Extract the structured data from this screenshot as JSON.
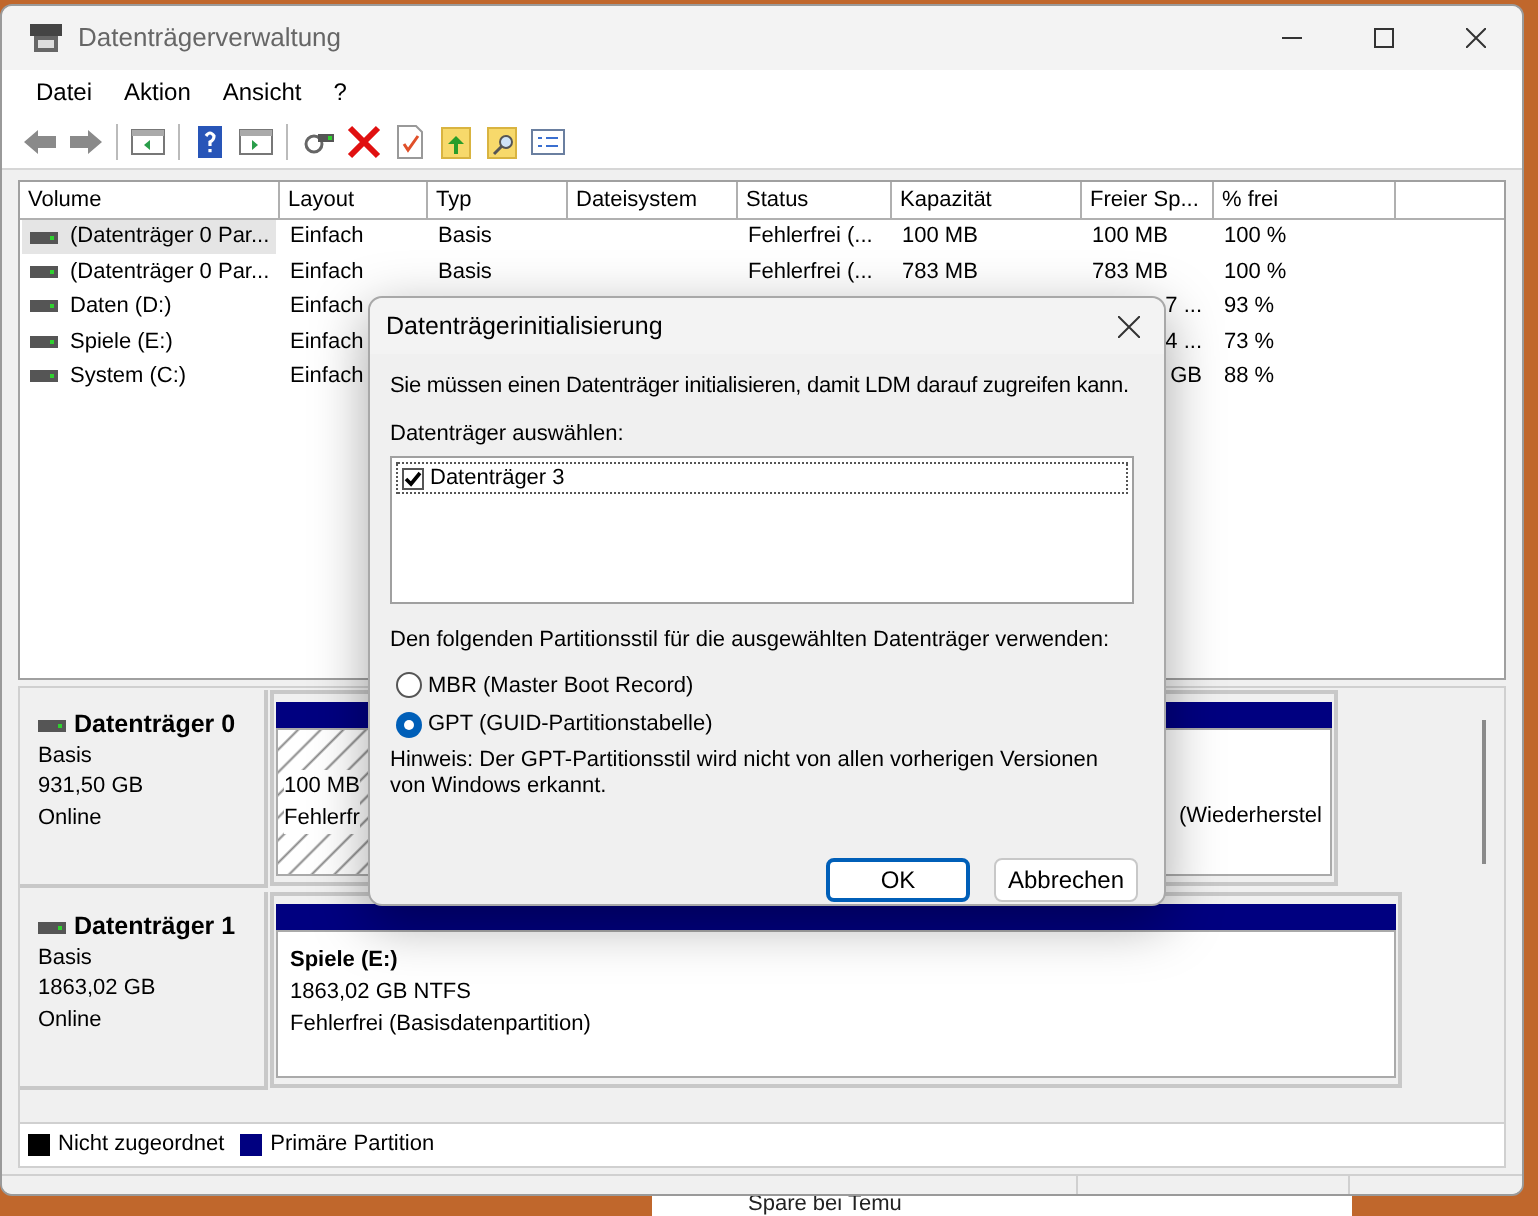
{
  "window": {
    "title": "Datenträgerverwaltung"
  },
  "menu": [
    "Datei",
    "Aktion",
    "Ansicht",
    "?"
  ],
  "table": {
    "columns": [
      "Volume",
      "Layout",
      "Typ",
      "Dateisystem",
      "Status",
      "Kapazität",
      "Freier Sp...",
      "% frei"
    ],
    "rows": [
      {
        "selected": true,
        "covered": false,
        "cells": [
          "(Datenträger 0 Par...",
          "Einfach",
          "Basis",
          null,
          "Fehlerfrei (...",
          "100 MB",
          "100 MB",
          "100 %"
        ]
      },
      {
        "selected": false,
        "covered": false,
        "cells": [
          "(Datenträger 0 Par...",
          "Einfach",
          "Basis",
          null,
          "Fehlerfrei (...",
          "783 MB",
          "783 MB",
          "100 %"
        ]
      },
      {
        "selected": false,
        "covered": true,
        "cells": [
          "Daten (D:)",
          "Einfach",
          null,
          null,
          null,
          null,
          "7 ...",
          "93 %"
        ]
      },
      {
        "selected": false,
        "covered": true,
        "cells": [
          "Spiele (E:)",
          "Einfach",
          null,
          null,
          null,
          null,
          "4 ...",
          "73 %"
        ]
      },
      {
        "selected": false,
        "covered": true,
        "cells": [
          "System (C:)",
          "Einfach",
          null,
          null,
          null,
          null,
          "GB",
          "88 %"
        ]
      }
    ]
  },
  "disks": [
    {
      "name": "Datenträger 0",
      "type": "Basis",
      "size": "931,50 GB",
      "status": "Online",
      "partitions": [
        {
          "kind": "hatched",
          "lines": [
            "100 MB",
            "Fehlerfr"
          ]
        },
        {
          "kind": "trailing",
          "lines": [
            "(Wiederherstel"
          ]
        }
      ]
    },
    {
      "name": "Datenträger 1",
      "type": "Basis",
      "size": "1863,02 GB",
      "status": "Online",
      "partitions": [
        {
          "kind": "primary",
          "title": "Spiele  (E:)",
          "lines": [
            "1863,02 GB NTFS",
            "Fehlerfrei (Basisdatenpartition)"
          ]
        }
      ]
    }
  ],
  "legend": [
    {
      "label": "Nicht zugeordnet",
      "color": "#000000"
    },
    {
      "label": "Primäre Partition",
      "color": "#000080"
    }
  ],
  "dialog": {
    "title": "Datenträgerinitialisierung",
    "message": "Sie müssen einen Datenträger initialisieren, damit LDM darauf zugreifen kann.",
    "select_label": "Datenträger auswählen:",
    "disks": [
      {
        "label": "Datenträger 3",
        "checked": true
      }
    ],
    "style_label": "Den folgenden Partitionsstil für die ausgewählten Datenträger verwenden:",
    "styles": [
      {
        "label": "MBR (Master Boot Record)",
        "selected": false
      },
      {
        "label": "GPT (GUID-Partitionstabelle)",
        "selected": true
      }
    ],
    "note": "Hinweis: Der GPT-Partitionsstil wird nicht von allen vorherigen Versionen von Windows erkannt.",
    "buttons": [
      {
        "label": "OK",
        "default": true
      },
      {
        "label": "Abbrechen",
        "default": false
      }
    ]
  },
  "background": {
    "ad_text": "Spare bei Temu"
  }
}
